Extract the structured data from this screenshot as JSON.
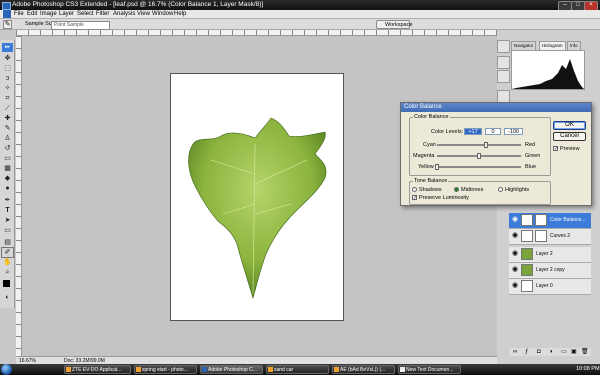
{
  "window": {
    "title": "Adobe Photoshop CS3 Extended - [leaf.psd @ 16.7% (Color Balance 1, Layer Mask/8)]"
  },
  "menu": [
    "File",
    "Edit",
    "Image",
    "Layer",
    "Select",
    "Filter",
    "Analysis",
    "View",
    "Window",
    "Help"
  ],
  "options": {
    "sample_size_label": "Sample Size:",
    "sample_size_value": "Point Sample",
    "workspace_label": "Workspace"
  },
  "panel_tabs": [
    "Navigator",
    "Histogram",
    "Info"
  ],
  "status": {
    "zoom": "16.67%",
    "doc": "Doc: 33.2M/99.0M"
  },
  "dialog": {
    "title": "Color Balance",
    "color_balance_group": "Color Balance",
    "color_levels_label": "Color Levels:",
    "levels": [
      "+17",
      "0",
      "-100"
    ],
    "sliders": [
      {
        "left": "Cyan",
        "right": "Red",
        "value": 17
      },
      {
        "left": "Magenta",
        "right": "Green",
        "value": 0
      },
      {
        "left": "Yellow",
        "right": "Blue",
        "value": -100
      }
    ],
    "tone_group": "Tone Balance",
    "tones": [
      "Shadows",
      "Midtones",
      "Highlights"
    ],
    "selected_tone": "Midtones",
    "preserve_label": "Preserve Luminosity",
    "preserve_checked": true,
    "ok": "OK",
    "cancel": "Cancel",
    "preview_label": "Preview",
    "preview_checked": true
  },
  "layers": [
    {
      "name": "Color Balance...",
      "selected": true
    },
    {
      "name": "Curves 2",
      "selected": false
    },
    {
      "name": "Layer 2",
      "selected": false
    },
    {
      "name": "Layer 2 copy",
      "selected": false
    },
    {
      "name": "Layer 0",
      "selected": false
    }
  ],
  "taskbar": {
    "tasks": [
      "ZTE EV-DO Applicat...",
      "spring start - photo...",
      "Adobe Photoshop C...",
      "sand car",
      "AE (bAd BeVsL)) (...",
      "New Text Documen..."
    ],
    "clock": "10:08 PM"
  },
  "colors": {
    "accent": "#3c7bd9",
    "leaf_dark": "#4f7a1e",
    "leaf_light": "#b6d46a"
  }
}
